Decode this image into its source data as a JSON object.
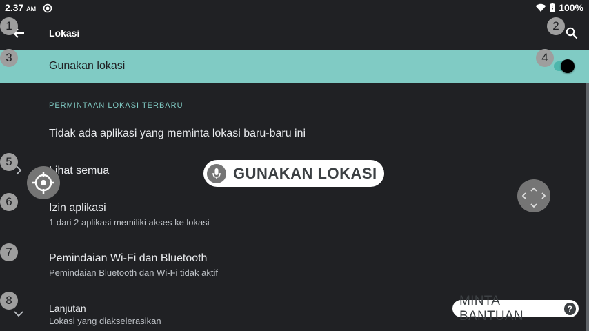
{
  "status_bar": {
    "time": "2.37",
    "ampm": "AM",
    "battery": "100%",
    "icons": [
      "sync-icon",
      "wifi-icon",
      "battery-icon"
    ]
  },
  "app_bar": {
    "title": "Lokasi",
    "back_icon": "arrow-left-icon",
    "search_icon": "search-icon"
  },
  "main_toggle": {
    "label": "Gunakan lokasi",
    "enabled": true
  },
  "section": {
    "header": "PERMINTAAN LOKASI TERBARU",
    "empty_message": "Tidak ada aplikasi yang meminta lokasi baru-baru ini",
    "see_all": "Lihat semua"
  },
  "items": [
    {
      "title": "Izin aplikasi",
      "subtitle": "1 dari 2 aplikasi memiliki akses ke lokasi"
    },
    {
      "title": "Pemindaian Wi-Fi dan Bluetooth",
      "subtitle": "Pemindaian Bluetooth dan Wi-Fi tidak aktif"
    },
    {
      "title": "Lanjutan",
      "subtitle": "Lokasi yang diakselerasikan"
    }
  ],
  "overlay": {
    "voice_chip": "GUNAKAN LOKASI",
    "help_chip": "MINTA BANTUAN",
    "help_symbol": "?",
    "badges": [
      "1",
      "2",
      "3",
      "4",
      "5",
      "6",
      "7",
      "8"
    ]
  },
  "colors": {
    "background": "#202124",
    "accent": "#80cbc4",
    "badge": "#9e9e9e"
  }
}
